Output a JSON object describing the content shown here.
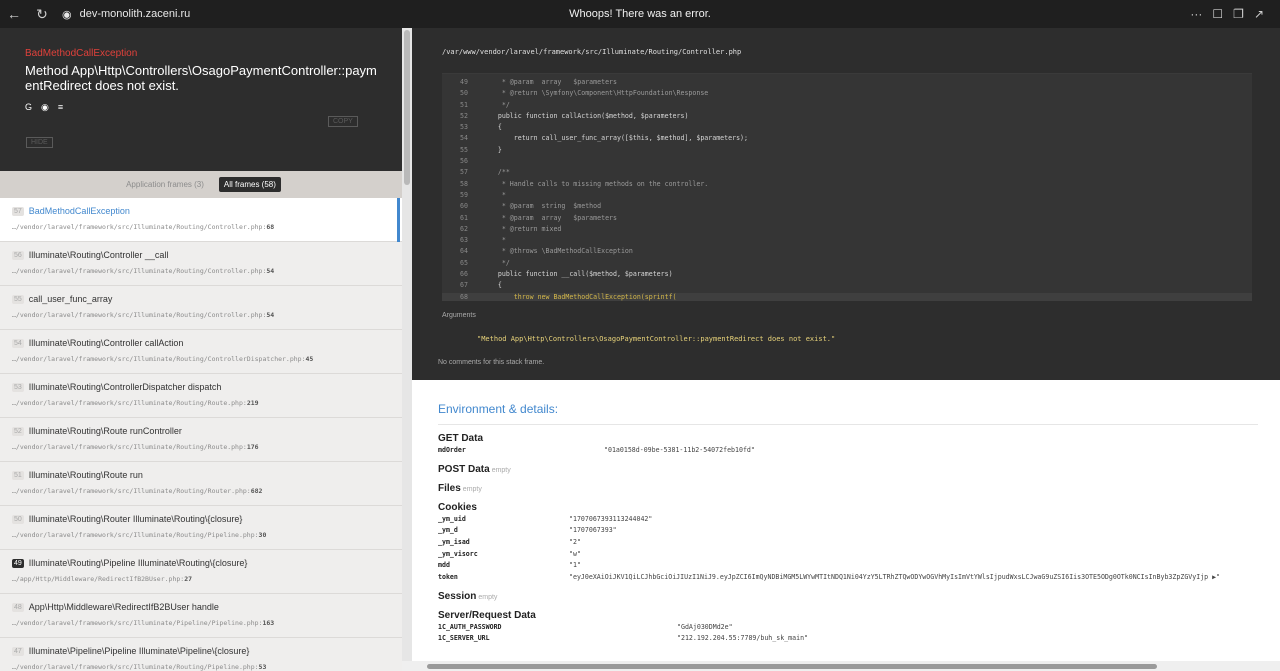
{
  "browser": {
    "url": "dev-monolith.zaceni.ru",
    "tab_title": "Whoops! There was an error."
  },
  "exception": {
    "name": "BadMethodCallException",
    "message": "Method App\\Http\\Controllers\\OsagoPaymentController::paymentRedirect does not exist.",
    "copy_label": "COPY",
    "hide_label": "HIDE",
    "search_icons": [
      "google-icon",
      "duckduckgo-icon",
      "stackoverflow-icon"
    ]
  },
  "frame_tabs": {
    "application": "Application frames (3)",
    "all": "All frames (58)"
  },
  "frames": [
    {
      "num": "57",
      "title": "BadMethodCallException",
      "file": "…/vendor/laravel/framework/src/Illuminate/Routing/Controller.php",
      "line": "68"
    },
    {
      "num": "56",
      "title": "Illuminate\\Routing\\Controller __call",
      "file": "…/vendor/laravel/framework/src/Illuminate/Routing/Controller.php",
      "line": "54"
    },
    {
      "num": "55",
      "title": "call_user_func_array",
      "file": "…/vendor/laravel/framework/src/Illuminate/Routing/Controller.php",
      "line": "54"
    },
    {
      "num": "54",
      "title": "Illuminate\\Routing\\Controller callAction",
      "file": "…/vendor/laravel/framework/src/Illuminate/Routing/ControllerDispatcher.php",
      "line": "45"
    },
    {
      "num": "53",
      "title": "Illuminate\\Routing\\ControllerDispatcher dispatch",
      "file": "…/vendor/laravel/framework/src/Illuminate/Routing/Route.php",
      "line": "219"
    },
    {
      "num": "52",
      "title": "Illuminate\\Routing\\Route runController",
      "file": "…/vendor/laravel/framework/src/Illuminate/Routing/Route.php",
      "line": "176"
    },
    {
      "num": "51",
      "title": "Illuminate\\Routing\\Route run",
      "file": "…/vendor/laravel/framework/src/Illuminate/Routing/Router.php",
      "line": "682"
    },
    {
      "num": "50",
      "title": "Illuminate\\Routing\\Router Illuminate\\Routing\\{closure}",
      "file": "…/vendor/laravel/framework/src/Illuminate/Routing/Pipeline.php",
      "line": "30"
    },
    {
      "num": "49",
      "title": "Illuminate\\Routing\\Pipeline Illuminate\\Routing\\{closure}",
      "file": "…/app/Http/Middleware/RedirectIfB2BUser.php",
      "line": "27"
    },
    {
      "num": "48",
      "title": "App\\Http\\Middleware\\RedirectIfB2BUser handle",
      "file": "…/vendor/laravel/framework/src/Illuminate/Pipeline/Pipeline.php",
      "line": "163"
    },
    {
      "num": "47",
      "title": "Illuminate\\Pipeline\\Pipeline Illuminate\\Pipeline\\{closure}",
      "file": "…/vendor/laravel/framework/src/Illuminate/Routing/Pipeline.php",
      "line": "53"
    }
  ],
  "code": {
    "file_path": "/var/www/vendor/laravel/framework/src/Illuminate/Routing/Controller.php",
    "lines": [
      {
        "n": "49",
        "t": "     * @param  array   $parameters",
        "c": "cmt"
      },
      {
        "n": "50",
        "t": "     * @return \\Symfony\\Component\\HttpFoundation\\Response",
        "c": "cmt"
      },
      {
        "n": "51",
        "t": "     */",
        "c": "cmt"
      },
      {
        "n": "52",
        "t": "    public function callAction($method, $parameters)",
        "c": ""
      },
      {
        "n": "53",
        "t": "    {",
        "c": ""
      },
      {
        "n": "54",
        "t": "        return call_user_func_array([$this, $method], $parameters);",
        "c": ""
      },
      {
        "n": "55",
        "t": "    }",
        "c": ""
      },
      {
        "n": "56",
        "t": "",
        "c": ""
      },
      {
        "n": "57",
        "t": "    /**",
        "c": "cmt"
      },
      {
        "n": "58",
        "t": "     * Handle calls to missing methods on the controller.",
        "c": "cmt"
      },
      {
        "n": "59",
        "t": "     *",
        "c": "cmt"
      },
      {
        "n": "60",
        "t": "     * @param  string  $method",
        "c": "cmt"
      },
      {
        "n": "61",
        "t": "     * @param  array   $parameters",
        "c": "cmt"
      },
      {
        "n": "62",
        "t": "     * @return mixed",
        "c": "cmt"
      },
      {
        "n": "63",
        "t": "     *",
        "c": "cmt"
      },
      {
        "n": "64",
        "t": "     * @throws \\BadMethodCallException",
        "c": "cmt"
      },
      {
        "n": "65",
        "t": "     */",
        "c": "cmt"
      },
      {
        "n": "66",
        "t": "    public function __call($method, $parameters)",
        "c": ""
      },
      {
        "n": "67",
        "t": "    {",
        "c": ""
      },
      {
        "n": "68",
        "t": "        throw new BadMethodCallException(sprintf(",
        "c": "kw"
      }
    ],
    "arguments_label": "Arguments",
    "argument": "\"Method App\\Http\\Controllers\\OsagoPaymentController::paymentRedirect does not exist.\"",
    "no_comments": "No comments for this stack frame."
  },
  "env": {
    "title": "Environment & details:",
    "empty_label": "empty",
    "get_title": "GET Data",
    "get": [
      {
        "k": "mdOrder",
        "v": "\"01a0158d-09be-5381-11b2-54072feb10fd\""
      }
    ],
    "post_title": "POST Data",
    "files_title": "Files",
    "cookies_title": "Cookies",
    "cookies": [
      {
        "k": "_ym_uid",
        "v": "\"1707067393113244042\""
      },
      {
        "k": "_ym_d",
        "v": "\"1707067393\""
      },
      {
        "k": "_ym_isad",
        "v": "\"2\""
      },
      {
        "k": "_ym_visorc",
        "v": "\"w\""
      },
      {
        "k": "mdd",
        "v": "\"1\""
      },
      {
        "k": "token",
        "v": "\"eyJ0eXAiOiJKV1QiLCJhbGciOiJIUzI1NiJ9.eyJpZCI6ImQyNDBiMGM5LWYwMTItNDQ1Ni04YzY5LTRhZTQwODYwOGVhMyIsImVtYWlsIjpudWxsLCJwaG9uZSI6Iis3OTE5ODg0OTk0NCIsInByb3ZpZGVyIjp ▶\""
      }
    ],
    "session_title": "Session",
    "server_title": "Server/Request Data",
    "server": [
      {
        "k": "1C_AUTH_PASSWORD",
        "v": "\"GdAj030DMd2e\""
      },
      {
        "k": "1C_SERVER_URL",
        "v": "\"212.192.204.55:7789/buh_sk_main\""
      }
    ]
  }
}
